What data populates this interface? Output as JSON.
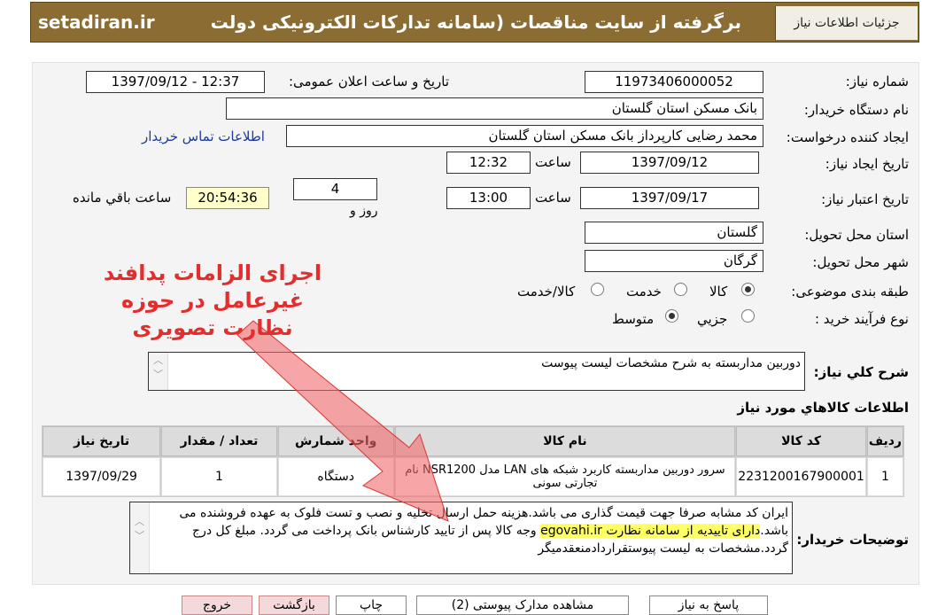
{
  "header": {
    "tab_label": "جزئيات اطلاعات نياز",
    "banner_title": "برگرفته از سایت مناقصات (سامانه تدارکات الکترونیکی دولت",
    "banner_site": "setadiran.ir"
  },
  "form": {
    "need_number_label": "شماره نیاز:",
    "need_number_value": "11973406000052",
    "announce_label": "تاریخ و ساعت اعلان عمومی:",
    "announce_value": "1397/09/12 - 12:37",
    "buyer_org_label": "نام دستگاه خریدار:",
    "buyer_org_value": "بانک مسکن استان گلستان",
    "requester_label": "ایجاد کننده درخواست:",
    "requester_value": "محمد  رضایی کارپرداز بانک مسکن استان گلستان",
    "contact_link": "اطلاعات تماس خریدار",
    "created_label": "تاریخ ایجاد نیاز:",
    "created_date": "1397/09/12",
    "time_label": "ساعت",
    "created_time": "12:32",
    "validity_label": "تاریخ اعتبار نیاز:",
    "validity_date": "1397/09/17",
    "validity_time": "13:00",
    "days_value": "4",
    "days_label": "روز و",
    "remaining_value": "20:54:36",
    "remaining_label": "ساعت باقي مانده",
    "province_label": "استان محل تحویل:",
    "province_value": "گلستان",
    "city_label": "شهر محل تحویل:",
    "city_value": "گرگان",
    "category_label": "طبقه بندی موضوعی:",
    "category_options": [
      "کالا",
      "خدمت",
      "کالا/خدمت"
    ],
    "category_selected": "کالا",
    "process_label": "نوع فرآیند خرید :",
    "process_options": [
      "جزیي",
      "متوسط"
    ],
    "process_selected": "متوسط",
    "summary_label": "شرح کلي نياز:",
    "summary_value": "دوربین مداربسته به شرح مشخصات لیست پیوست",
    "items_title": "اطلاعات کالاهاي مورد نياز",
    "notes_label": "توضیحات خریدار:",
    "notes_part1": "ایران کد مشابه صرفا جهت قیمت گذاری می باشد.هزینه حمل ارسال تخلیه و نصب و تست فلوک به عهده فروشنده می باشد.",
    "notes_highlight": "دارای تاییدیه از سامانه نظارت egovahi.ir",
    "notes_part2": " وجه کالا پس از تایید کارشناس بانک پرداخت می گردد. مبلغ کل درج گردد.مشخصات به لیست پیوستقراردادمنعقدمیگر"
  },
  "table": {
    "headers": [
      "ردیف",
      "کد کالا",
      "نام کالا",
      "واحد شمارش",
      "تعداد / مقدار",
      "تاریخ نیاز"
    ],
    "rows": [
      [
        "1",
        "2231200167900001",
        "سرور دوربین مداربسته کاربرد شبکه های LAN مدل NSR1200 نام تجارتی سونی",
        "دستگاه",
        "1",
        "1397/09/29"
      ]
    ]
  },
  "overlay": {
    "line1": "اجرای الزامات پدافند",
    "line2": "غیرعامل در حوزه",
    "line3": "نظارت تصویری"
  },
  "buttons": {
    "answer": "پاسخ به نیاز",
    "view_docs": "مشاهده مدارک پیوستی (2)",
    "print": "چاپ",
    "back": "بازگشت",
    "exit": "خروج"
  },
  "colors": {
    "banner": "#8b6d34",
    "overlay_text": "#e42d2d",
    "link": "#1a3a9e"
  }
}
